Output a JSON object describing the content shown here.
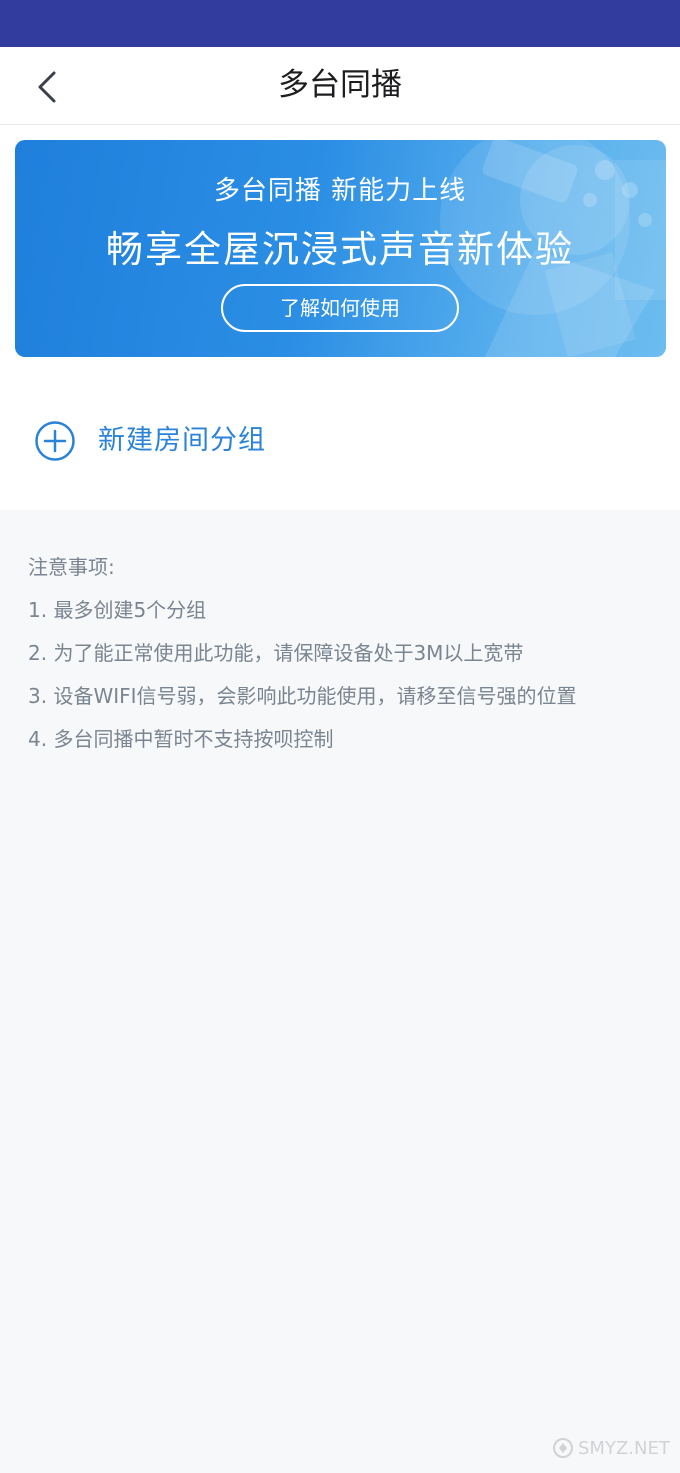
{
  "status_bar": {
    "color": "#323b9e"
  },
  "nav": {
    "title": "多台同播",
    "back_icon": "chevron-left-icon"
  },
  "banner": {
    "subtitle": "多台同播 新能力上线",
    "title": "畅享全屋沉浸式声音新体验",
    "button_label": "了解如何使用",
    "accent_color": "#2b8ee4"
  },
  "add_group": {
    "icon": "plus-circle-icon",
    "label": "新建房间分组",
    "color": "#2b83d8"
  },
  "notes": {
    "heading": "注意事项:",
    "items": [
      "1. 最多创建5个分组",
      "2. 为了能正常使用此功能，请保障设备处于3M以上宽带",
      "3. 设备WIFI信号弱，会影响此功能使用，请移至信号强的位置",
      "4. 多台同播中暂时不支持按呗控制"
    ]
  },
  "watermark": {
    "text": "SMYZ.NET",
    "icon": "watermark-logo-icon"
  }
}
